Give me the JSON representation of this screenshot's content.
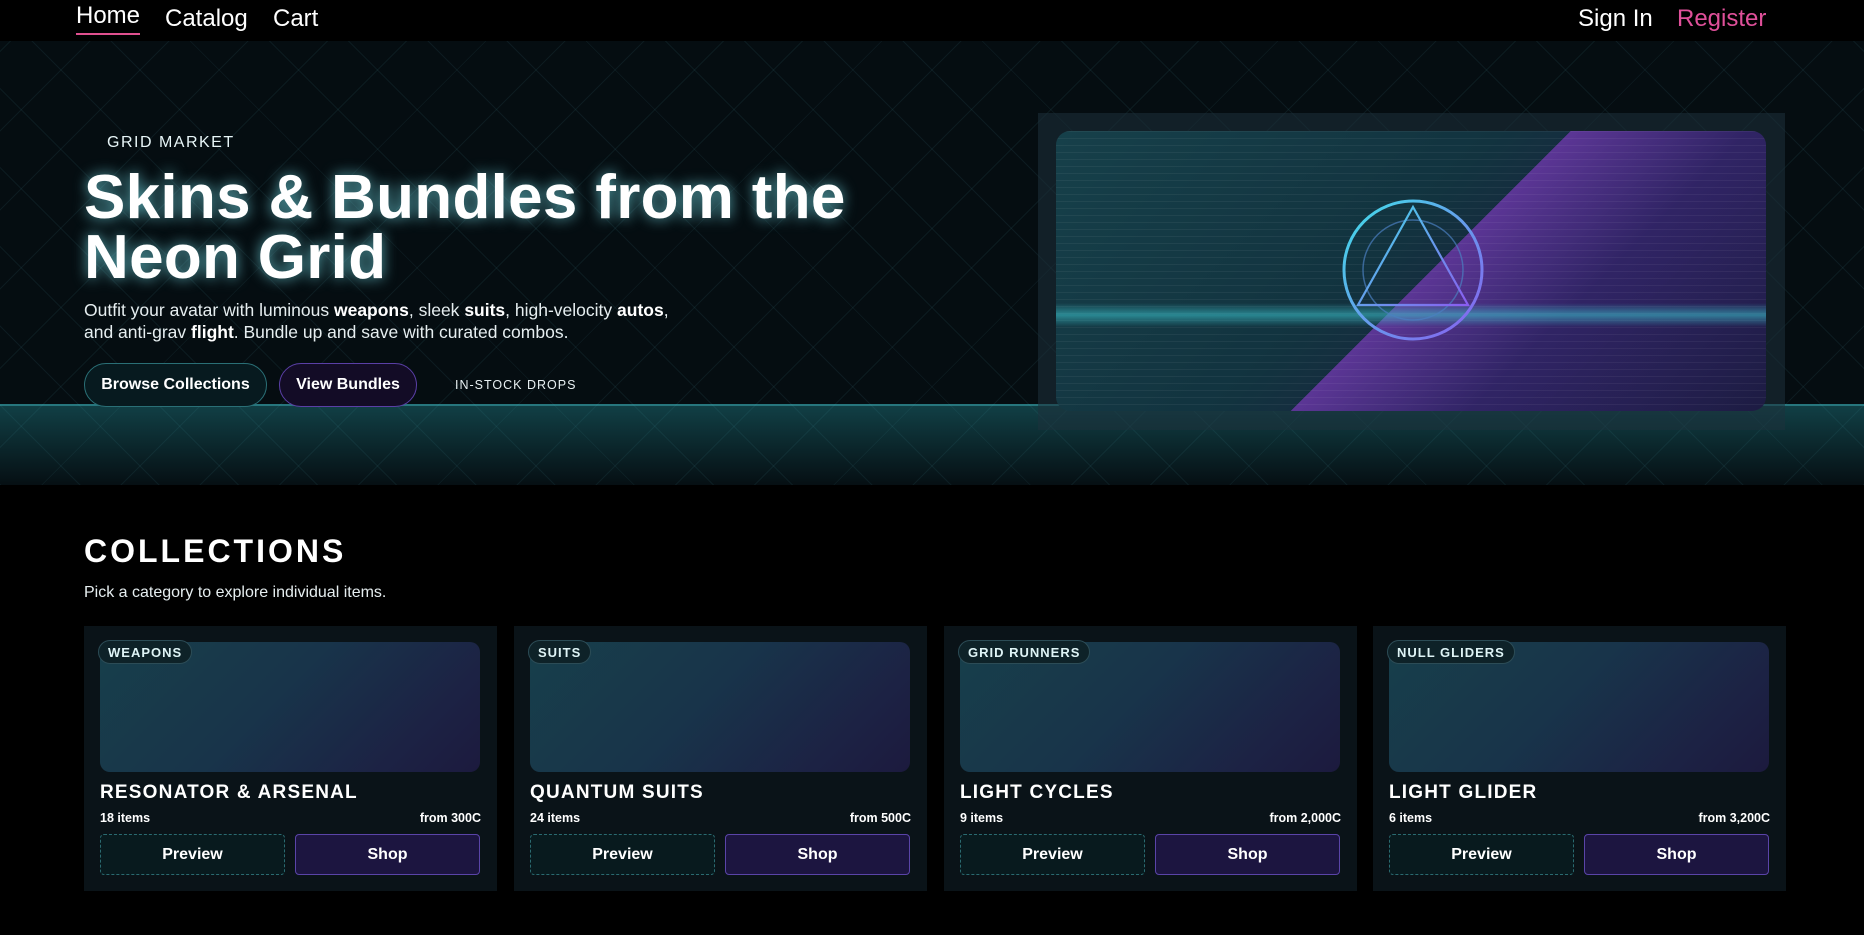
{
  "nav": {
    "home": "Home",
    "catalog": "Catalog",
    "cart": "Cart",
    "sign_in": "Sign In",
    "register": "Register"
  },
  "hero": {
    "eyebrow": "GRID MARKET",
    "title": "Skins & Bundles from the Neon Grid",
    "lead": {
      "t1": "Outfit your avatar with luminous ",
      "b1": "weapons",
      "t2": ", sleek ",
      "b2": "suits",
      "t3": ", high-velocity ",
      "b3": "autos",
      "t4": ", and anti-grav ",
      "b4": "flight",
      "t5": ". Bundle up and save with curated combos."
    },
    "browse_label": "Browse Collections",
    "bundles_label": "View Bundles",
    "instock_label": "IN-STOCK DROPS"
  },
  "collections": {
    "title": "COLLECTIONS",
    "subtitle": "Pick a category to explore individual items.",
    "cards": [
      {
        "tag": "WEAPONS",
        "name": "RESONATOR & ARSENAL",
        "count": "18 items",
        "price": "from 300C",
        "preview": "Preview",
        "shop": "Shop"
      },
      {
        "tag": "SUITS",
        "name": "QUANTUM SUITS",
        "count": "24 items",
        "price": "from 500C",
        "preview": "Preview",
        "shop": "Shop"
      },
      {
        "tag": "GRID RUNNERS",
        "name": "LIGHT CYCLES",
        "count": "9 items",
        "price": "from 2,000C",
        "preview": "Preview",
        "shop": "Shop"
      },
      {
        "tag": "NULL GLIDERS",
        "name": "LIGHT GLIDER",
        "count": "6 items",
        "price": "from 3,200C",
        "preview": "Preview",
        "shop": "Shop"
      }
    ]
  },
  "colors": {
    "accent_pink": "#e0509a",
    "accent_cyan": "#2a6f76",
    "accent_violet": "#5a44a8"
  },
  "icons": {
    "hero_emblem": "circle-triangle-emblem-icon"
  }
}
